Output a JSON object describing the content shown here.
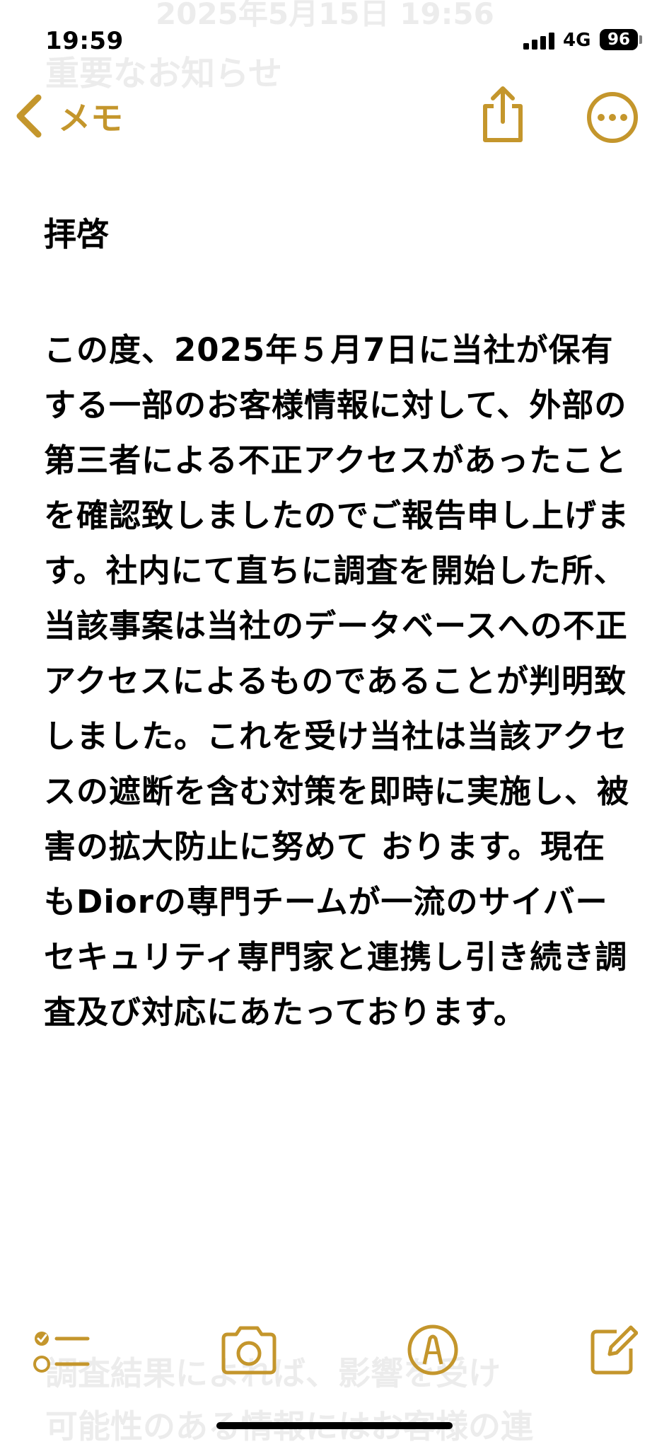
{
  "status_bar": {
    "time": "19:59",
    "network": "4G",
    "battery": "96"
  },
  "background_text": {
    "top_date": "2025年5月15日 19:56",
    "top_title": "重要なお知らせ",
    "bottom_line_1": "調査結果によれば、影響を受け",
    "bottom_line_2": "可能性のある情報にはお客様の連"
  },
  "nav": {
    "back_label": "メモ"
  },
  "note": {
    "salutation": "拝啓",
    "body": "この度、2025年５月7日に当社が保有する一部のお客様情報に対して、外部の第三者による不正アクセスがあったことを確認致しましたのでご報告申し上げます。社内にて直ちに調査を開始した所、当該事案は当社のデータベースへの不正アクセスによるものであることが判明致しました。これを受け当社は当該アクセスの遮断を含む対策を即時に実施し、被害の拡大防止に努めて おります。現在もDiorの専門チームが一流のサイバーセキュリティ専門家と連携し引き続き調査及び対応にあたっております。"
  },
  "colors": {
    "accent": "#c4962c",
    "text": "#000000",
    "background": "#ffffff"
  },
  "icons": {
    "back": "chevron-left-icon",
    "share": "share-icon",
    "more": "ellipsis-circle-icon",
    "checklist": "checklist-icon",
    "camera": "camera-icon",
    "markup": "markup-pen-icon",
    "compose": "compose-icon"
  }
}
